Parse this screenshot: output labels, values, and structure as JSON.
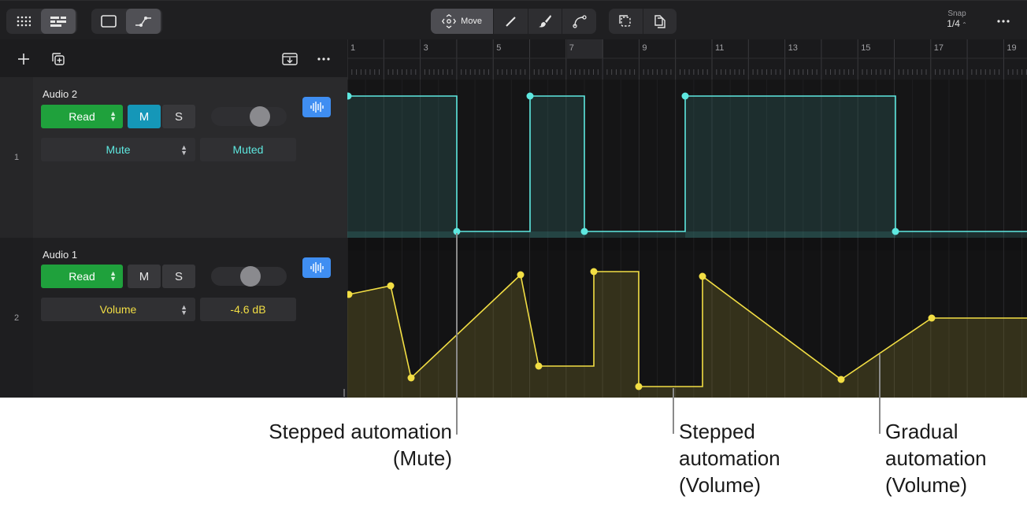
{
  "toolbar": {
    "move_label": "Move",
    "snap_label": "Snap",
    "snap_value": "1/4",
    "icons": [
      "grid-view-icon",
      "tracks-view-icon",
      "rectangle-view-icon",
      "automation-curve-icon",
      "move-icon",
      "pencil-icon",
      "brush-icon",
      "curve-tool-icon",
      "region-select-icon",
      "copy-document-icon",
      "more-icon"
    ]
  },
  "ruler": {
    "bars": [
      "1",
      "3",
      "5",
      "7",
      "9",
      "11",
      "13",
      "15",
      "17",
      "19"
    ]
  },
  "tracks": [
    {
      "number": "1",
      "name": "Audio 2",
      "automation_mode": "Read",
      "mute_label": "M",
      "solo_label": "S",
      "mute_active": true,
      "parameter": "Mute",
      "parameter_value": "Muted",
      "color": "#5ee8e0"
    },
    {
      "number": "2",
      "name": "Audio 1",
      "automation_mode": "Read",
      "mute_label": "M",
      "solo_label": "S",
      "mute_active": false,
      "parameter": "Volume",
      "parameter_value": "-4.6 dB",
      "color": "#f2de44"
    }
  ],
  "callouts": {
    "stepped_mute": {
      "line1": "Stepped automation",
      "line2": "(Mute)"
    },
    "stepped_volume": {
      "line1": "Stepped",
      "line2": "automation",
      "line3": "(Volume)"
    },
    "gradual_volume": {
      "line1": "Gradual",
      "line2": "automation",
      "line3": "(Volume)"
    }
  }
}
